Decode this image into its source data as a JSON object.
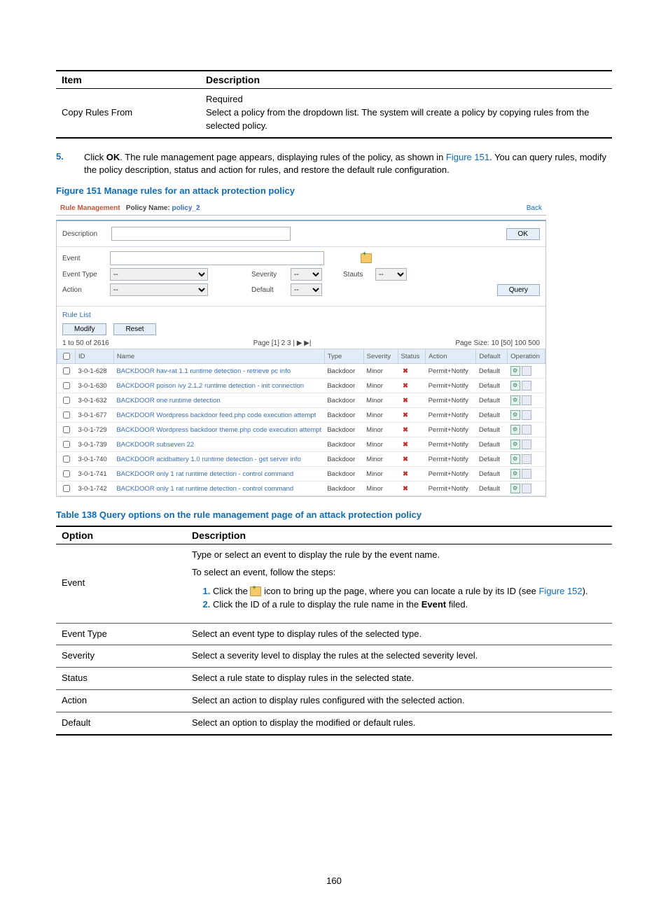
{
  "top_table": {
    "headers": [
      "Item",
      "Description"
    ],
    "row_item": "Copy Rules From",
    "row_desc_line1": "Required",
    "row_desc_line2": "Select a policy from the dropdown list. The system will create a policy by copying rules from the selected policy."
  },
  "step5": {
    "num": "5.",
    "text_a": "Click ",
    "text_ok": "OK",
    "text_b": ". The rule management page appears, displaying rules of the policy, as shown in ",
    "link": "Figure 151",
    "text_c": ". You can query rules, modify the policy description, status and action for rules, and restore the default rule configuration."
  },
  "figure_caption": "Figure 151 Manage rules for an attack protection policy",
  "screenshot": {
    "header_a": "Rule Management",
    "header_b": "Policy Name:",
    "policy_name": "policy_2",
    "back": "Back",
    "desc_label": "Description",
    "ok_btn": "OK",
    "filter": {
      "event": "Event",
      "event_type": "Event Type",
      "action": "Action",
      "severity": "Severity",
      "default": "Default",
      "status": "Stauts",
      "query": "Query",
      "sel_placeholder": "--"
    },
    "rule_list_hdr": "Rule List",
    "modify_btn": "Modify",
    "reset_btn": "Reset",
    "pager_left": "1 to 50 of 2616",
    "pager_mid": "Page [1] 2 3 | ▶ ▶|",
    "pager_right": "Page Size: 10 [50] 100 500",
    "cols": [
      "",
      "ID",
      "Name",
      "Type",
      "Severity",
      "Status",
      "Action",
      "Default",
      "Operation"
    ],
    "rows": [
      {
        "id": "3-0-1-628",
        "name": "BACKDOOR hav-rat 1.1 runtime detection - retrieve pc info",
        "type": "Backdoor",
        "severity": "Minor",
        "action": "Permit+Notify",
        "default": "Default"
      },
      {
        "id": "3-0-1-630",
        "name": "BACKDOOR poison ivy 2.1.2 runtime detection - init connection",
        "type": "Backdoor",
        "severity": "Minor",
        "action": "Permit+Notify",
        "default": "Default"
      },
      {
        "id": "3-0-1-632",
        "name": "BACKDOOR one runtime detection",
        "type": "Backdoor",
        "severity": "Minor",
        "action": "Permit+Notify",
        "default": "Default"
      },
      {
        "id": "3-0-1-677",
        "name": "BACKDOOR Wordpress backdoor feed.php code execution attempt",
        "type": "Backdoor",
        "severity": "Minor",
        "action": "Permit+Notify",
        "default": "Default"
      },
      {
        "id": "3-0-1-729",
        "name": "BACKDOOR Wordpress backdoor theme.php code execution attempt",
        "type": "Backdoor",
        "severity": "Minor",
        "action": "Permit+Notify",
        "default": "Default"
      },
      {
        "id": "3-0-1-739",
        "name": "BACKDOOR subseven 22",
        "type": "Backdoor",
        "severity": "Minor",
        "action": "Permit+Notify",
        "default": "Default"
      },
      {
        "id": "3-0-1-740",
        "name": "BACKDOOR acidbattery 1.0 runtime detection - get server info",
        "type": "Backdoor",
        "severity": "Minor",
        "action": "Permit+Notify",
        "default": "Default"
      },
      {
        "id": "3-0-1-741",
        "name": "BACKDOOR only 1 rat runtime detection - control command",
        "type": "Backdoor",
        "severity": "Minor",
        "action": "Permit+Notify",
        "default": "Default"
      },
      {
        "id": "3-0-1-742",
        "name": "BACKDOOR only 1 rat runtime detection - control command",
        "type": "Backdoor",
        "severity": "Minor",
        "action": "Permit+Notify",
        "default": "Default"
      }
    ]
  },
  "table138_caption": "Table 138 Query options on the rule management page of an attack protection policy",
  "table138": {
    "headers": [
      "Option",
      "Description"
    ],
    "event_opt": "Event",
    "event_l1": "Type or select an event to display the rule by the event name.",
    "event_l2": "To select an event, follow the steps:",
    "event_step1_a": "Click the ",
    "event_step1_b": " icon to bring up the page, where you can locate a rule by its ID (see ",
    "event_step1_link": "Figure 152",
    "event_step1_c": ").",
    "event_step2_a": "Click the ID of a rule to display the rule name in the ",
    "event_step2_bold": "Event",
    "event_step2_b": " filed.",
    "rows": [
      {
        "opt": "Event Type",
        "desc": "Select an event type to display rules of the selected type."
      },
      {
        "opt": "Severity",
        "desc": "Select a severity level to display the rules at the selected severity level."
      },
      {
        "opt": "Status",
        "desc": "Select a rule state to display rules in the selected state."
      },
      {
        "opt": "Action",
        "desc": "Select an action to display rules configured with the selected action."
      },
      {
        "opt": "Default",
        "desc": "Select an option to display the modified or default rules."
      }
    ]
  },
  "page_number": "160"
}
